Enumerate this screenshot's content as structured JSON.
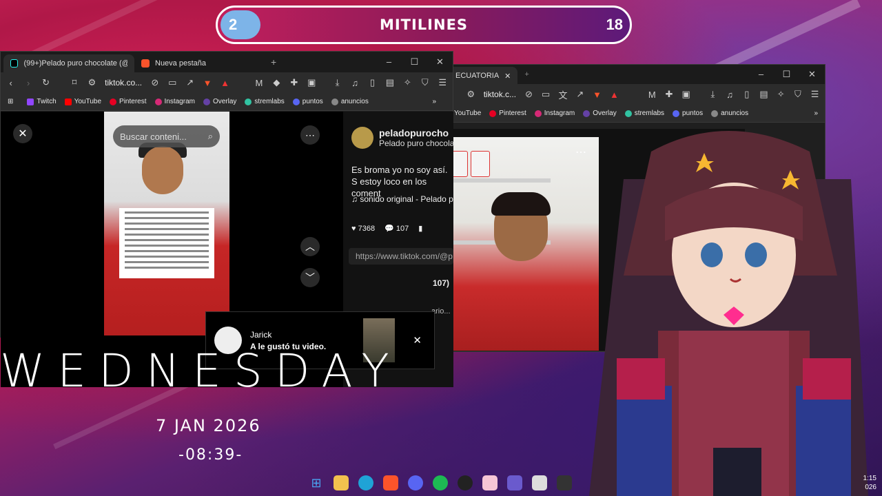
{
  "scoreboard": {
    "left_score": "2",
    "title": "MITILINES",
    "right_score": "18"
  },
  "left_browser": {
    "tabs": [
      {
        "label": "(99+)Pelado puro chocolate (@p",
        "active": true
      },
      {
        "label": "Nueva pestaña",
        "active": false
      }
    ],
    "url": "tiktok.co...",
    "bookmarks": [
      "Twitch",
      "YouTube",
      "Pinterest",
      "Instagram",
      "Overlay",
      "stremlabs",
      "puntos",
      "anuncios"
    ],
    "search_placeholder": "Buscar conteni...",
    "profile": {
      "handle": "peladopurocho",
      "name": "Pelado puro chocola"
    },
    "caption": "Es broma yo no soy así. S estoy loco en los coment",
    "sound": "sonido original - Pelado p",
    "likes": "7368",
    "comments": "107",
    "link": "https://www.tiktok.com/@p",
    "comment_count_partial": "107)",
    "partial_text": "ario...",
    "notification": {
      "user": "Jarick",
      "message": "A le gustó tu video."
    }
  },
  "right_browser": {
    "tab_label": "ECUATORIA",
    "url": "tiktok.c...",
    "bookmarks": [
      "YouTube",
      "Pinterest",
      "Instagram",
      "Overlay",
      "stremlabs",
      "puntos",
      "anuncios"
    ]
  },
  "desktop": {
    "day": "WEDNESDAY",
    "date": "7 JAN 2026",
    "time": "-08:39-",
    "clock_time": "1:15",
    "clock_year": "026"
  },
  "colors": {
    "accent_pink": "#e0245e",
    "tiktok_red": "#fe2c55",
    "score_blue": "#7db4e8"
  }
}
